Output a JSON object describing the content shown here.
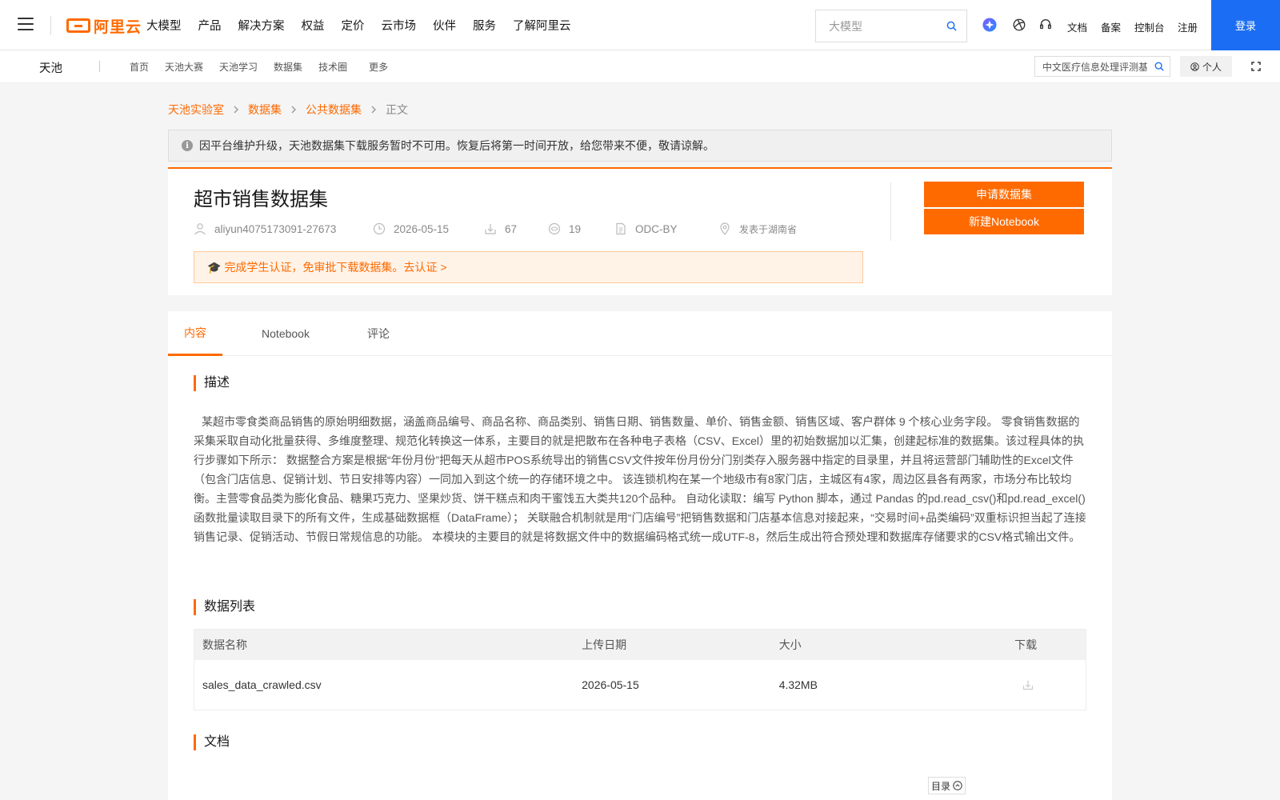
{
  "topnav": {
    "logo_text": "阿里云",
    "menu": [
      "大模型",
      "产品",
      "解决方案",
      "权益",
      "定价",
      "云市场",
      "伙伴",
      "服务",
      "了解阿里云"
    ],
    "search_placeholder": "大模型",
    "links": [
      "文档",
      "备案",
      "控制台",
      "注册"
    ],
    "login_label": "登录",
    "icons": [
      "ai-assistant-icon",
      "globe-icon",
      "headset-icon"
    ]
  },
  "subnav": {
    "brand": "天池",
    "links": [
      "首页",
      "天池大赛",
      "天池学习",
      "数据集",
      "技术圈",
      "更多"
    ],
    "search_value": "中文医疗信息处理评测基",
    "personal_label": "个人"
  },
  "breadcrumb": [
    "天池实验室",
    "数据集",
    "公共数据集",
    "正文"
  ],
  "notice": "因平台维护升级，天池数据集下载服务暂时不可用。恢复后将第一时间开放，给您带来不便，敬请谅解。",
  "dataset": {
    "title": "超市销售数据集",
    "author": "aliyun4075173091-27673",
    "date": "2026-05-15",
    "downloads": "67",
    "views": "19",
    "license": "ODC-BY",
    "location": "发表于湖南省",
    "apply_label": "申请数据集",
    "notebook_label": "新建Notebook",
    "edu_text": "完成学生认证，免审批下载数据集。去认证 >"
  },
  "tabs": [
    "内容",
    "Notebook",
    "评论"
  ],
  "sections": {
    "desc_title": "描述",
    "desc_text": "某超市零食类商品销售的原始明细数据，涵盖商品编号、商品名称、商品类别、销售日期、销售数量、单价、销售金额、销售区域、客户群体 9 个核心业务字段。 零食销售数据的采集采取自动化批量获得、多维度整理、规范化转换这一体系，主要目的就是把散布在各种电子表格（CSV、Excel）里的初始数据加以汇集，创建起标准的数据集。该过程具体的执行步骤如下所示： 数据整合方案是根据“年份月份”把每天从超市POS系统导出的销售CSV文件按年份月份分门别类存入服务器中指定的目录里，并且将运营部门辅助性的Excel文件（包含门店信息、促销计划、节日安排等内容）一同加入到这个统一的存储环境之中。 该连锁机构在某一个地级市有8家门店，主城区有4家，周边区县各有两家，市场分布比较均衡。主营零食品类为膨化食品、糖果巧克力、坚果炒货、饼干糕点和肉干蜜饯五大类共120个品种。 自动化读取：编写 Python 脚本，通过 Pandas 的pd.read_csv()和pd.read_excel()函数批量读取目录下的所有文件，生成基础数据框（DataFrame）； 关联融合机制就是用“门店编号”把销售数据和门店基本信息对接起来，“交易时间+品类编码”双重标识担当起了连接销售记录、促销活动、节假日常规信息的功能。 本模块的主要目的就是将数据文件中的数据编码格式统一成UTF-8，然后生成出符合预处理和数据库存储要求的CSV格式输出文件。",
    "list_title": "数据列表",
    "docs_title": "文档"
  },
  "table": {
    "headers": [
      "数据名称",
      "上传日期",
      "大小",
      "下载"
    ],
    "rows": [
      {
        "name": "sales_data_crawled.csv",
        "date": "2026-05-15",
        "size": "4.32MB"
      }
    ]
  },
  "toc_label": "目录",
  "colors": {
    "accent": "#ff6a00",
    "login": "#1b6ef3"
  }
}
